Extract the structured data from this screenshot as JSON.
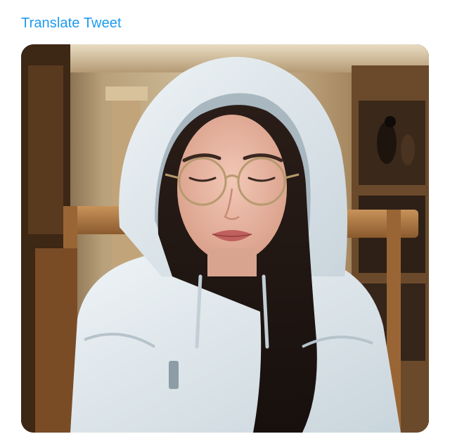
{
  "tweet": {
    "translate_label": "Translate Tweet"
  },
  "media": {
    "kind": "photo",
    "accent_color": "#1d9bf0",
    "background_tones": [
      "#c9b08a",
      "#7a5530",
      "#2b1d12"
    ],
    "hoodie_color": "#dfe8ee"
  }
}
